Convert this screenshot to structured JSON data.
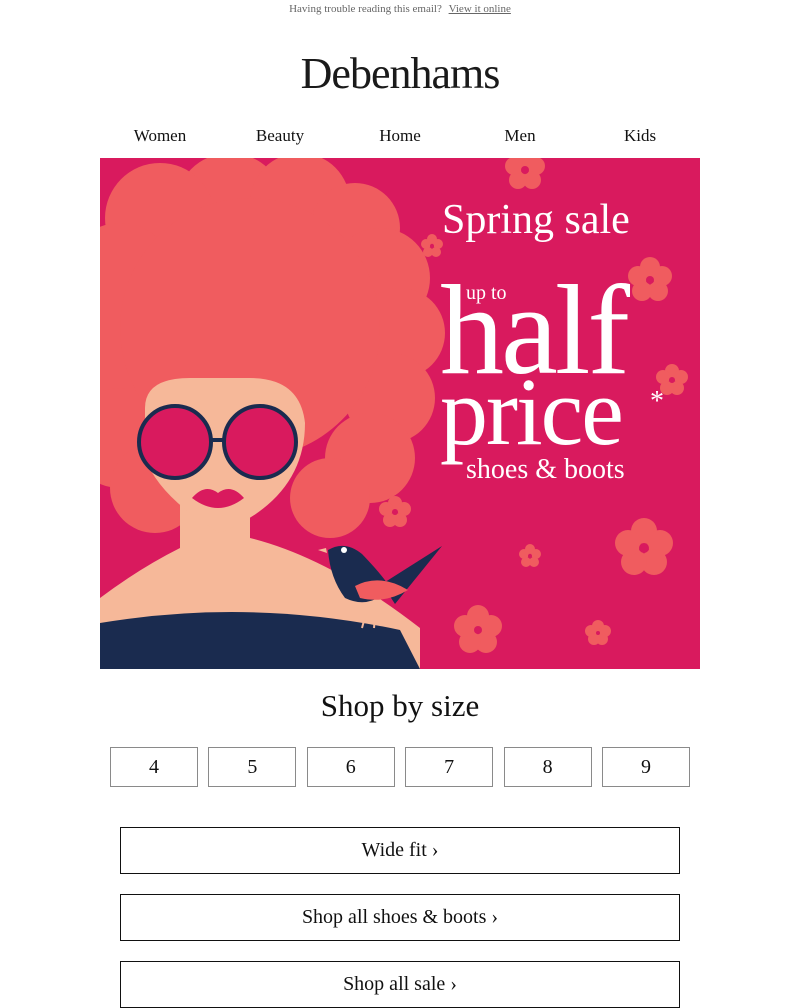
{
  "topbar": {
    "text": "Having trouble reading this email?",
    "link": "View it online"
  },
  "brand": {
    "logo": "Debenhams"
  },
  "nav": [
    "Women",
    "Beauty",
    "Home",
    "Men",
    "Kids"
  ],
  "hero": {
    "title": "Spring sale",
    "up_to": "up to",
    "half": "half",
    "price": "price",
    "asterisk": "*",
    "subtitle": "shoes & boots",
    "colors": {
      "background": "#d91a5e",
      "hair": "#f05c5f",
      "skin": "#f6b899",
      "navy": "#1a2b4f"
    }
  },
  "sizes": {
    "title": "Shop by size",
    "items": [
      "4",
      "5",
      "6",
      "7",
      "8",
      "9"
    ]
  },
  "buttons": {
    "wide_fit": "Wide fit ›",
    "shoes_boots": "Shop all shoes & boots ›",
    "sale": "Shop all sale ›"
  }
}
